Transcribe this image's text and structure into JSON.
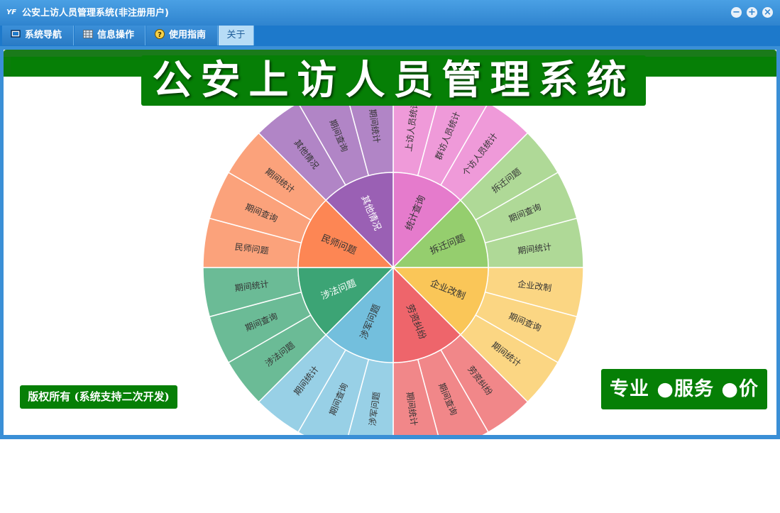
{
  "window": {
    "title": "公安上访人员管理系统(非注册用户)",
    "app_icon": "YF",
    "controls": [
      "minimize-icon",
      "maximize-icon",
      "close-icon"
    ]
  },
  "menu": {
    "items": [
      {
        "label": "系统导航",
        "icon": "monitor-icon"
      },
      {
        "label": "信息操作",
        "icon": "grid-icon"
      },
      {
        "label": "使用指南",
        "icon": "help-icon"
      },
      {
        "label": "关于",
        "icon": ""
      }
    ]
  },
  "banner": {
    "title": "公安上访人员管理系统"
  },
  "footer": {
    "copyright": "版权所有 (系统支持二次开发)",
    "slogan": "专业 ●服务 ●价值"
  },
  "wheel": {
    "categories": [
      {
        "label": "统计查询",
        "color": "#e57bcc",
        "outer_color": "#ef9ad9",
        "items": [
          "上访人员统计",
          "群访人员统计",
          "个访人员统计"
        ]
      },
      {
        "label": "拆迁问题",
        "color": "#95ce6e",
        "outer_color": "#afd997",
        "items": [
          "拆迁问题",
          "期间查询",
          "期间统计"
        ]
      },
      {
        "label": "企业改制",
        "color": "#fac658",
        "outer_color": "#fbd683",
        "items": [
          "企业改制",
          "期间查询",
          "期间统计"
        ]
      },
      {
        "label": "劳资纠纷",
        "color": "#ee656b",
        "outer_color": "#f18789",
        "items": [
          "劳资纠纷",
          "期间查询",
          "期间统计"
        ]
      },
      {
        "label": "涉军问题",
        "color": "#73bfdd",
        "outer_color": "#98d0e6",
        "items": [
          "涉军问题",
          "期间查询",
          "期间统计"
        ]
      },
      {
        "label": "涉法问题",
        "color": "#3ca475",
        "outer_color": "#6bbb96",
        "items": [
          "涉法问题",
          "期间查询",
          "期间统计"
        ]
      },
      {
        "label": "民师问题",
        "color": "#fd8654",
        "outer_color": "#fba27b",
        "items": [
          "民师问题",
          "期间查询",
          "期间统计"
        ]
      },
      {
        "label": "其他情况",
        "color": "#9a60b4",
        "outer_color": "#b185c6",
        "items": [
          "其他情况",
          "期间查询",
          "期间统计"
        ]
      }
    ]
  }
}
